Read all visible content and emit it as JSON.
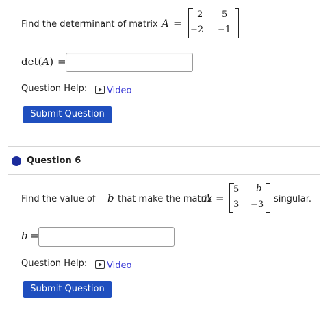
{
  "q5": {
    "prompt": "Find the determinant of matrix",
    "var": "A",
    "eq": "=",
    "matrix": {
      "r1c1": "2",
      "r1c2": "5",
      "r2c1": "−2",
      "r2c2": "−1"
    },
    "answer_label_fn": "det(",
    "answer_label_var": "A",
    "answer_label_close": ")",
    "answer_eq": "=",
    "answer_value": "",
    "help_label": "Question Help:",
    "video_label": "Video",
    "submit_label": "Submit Question"
  },
  "q6": {
    "title": "Question 6",
    "prompt_before": "Find the value of",
    "prompt_var": "b",
    "prompt_after": "that make the matrix",
    "var": "A",
    "eq": "=",
    "matrix": {
      "r1c1": "5",
      "r1c2": "b",
      "r2c1": "3",
      "r2c2": "−3"
    },
    "prompt_end": "singular.",
    "answer_var": "b",
    "answer_eq": "=",
    "answer_value": "",
    "help_label": "Question Help:",
    "video_label": "Video",
    "submit_label": "Submit Question"
  },
  "colors": {
    "button": "#1f4fbf",
    "link": "#3b3bd6",
    "dot": "#1c2c9c"
  }
}
